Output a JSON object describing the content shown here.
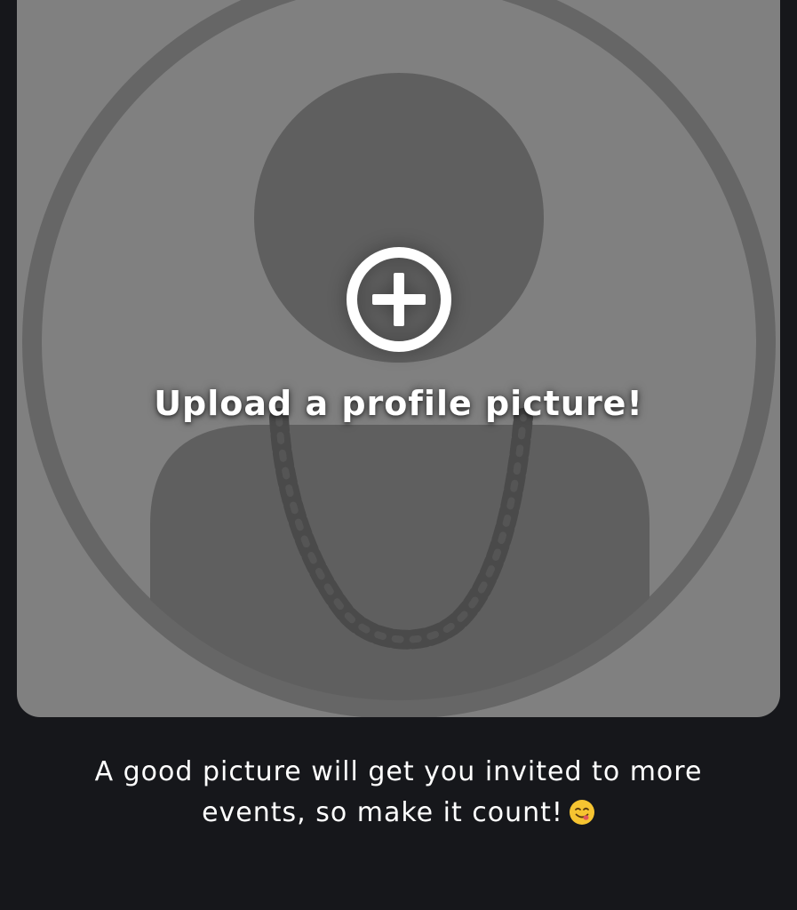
{
  "upload": {
    "label": "Upload a profile picture!",
    "icon": "plus-circle-icon"
  },
  "avatar": {
    "icon": "person-placeholder-icon",
    "accessory_icon": "gold-chain-icon"
  },
  "hint": {
    "text": "A good picture will get you invited to more events, so make it count!",
    "emoji_icon": "yum-face-emoji-icon"
  },
  "colors": {
    "background": "#16171b",
    "card": "#808080",
    "silhouette": "#5f5f5f",
    "ring": "#666666",
    "chain": "#4a4a4a",
    "text": "#ffffff"
  }
}
